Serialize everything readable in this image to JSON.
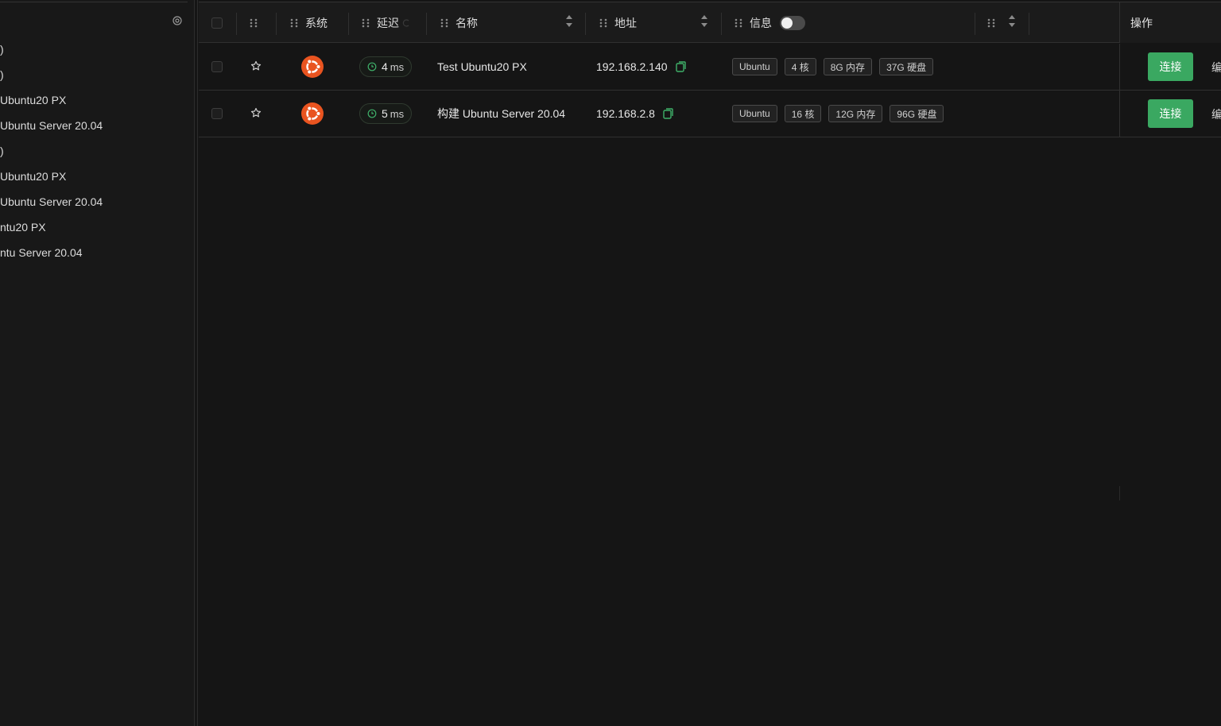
{
  "sidebar": {
    "items": [
      ")",
      ")",
      "Ubuntu20 PX",
      "Ubuntu Server 20.04",
      ")",
      "Ubuntu20 PX",
      "Ubuntu Server 20.04",
      "ntu20 PX",
      "ntu Server 20.04"
    ]
  },
  "table": {
    "headers": {
      "system": "系统",
      "latency": "延迟",
      "name": "名称",
      "address": "地址",
      "info": "信息",
      "operations": "操作"
    },
    "rows": [
      {
        "os": "ubuntu-icon",
        "latency_value": "4",
        "latency_unit": "ms",
        "name": "Test Ubuntu20 PX",
        "address": "192.168.2.140",
        "tags": [
          "Ubuntu",
          "4 核",
          "8G 内存",
          "37G 硬盘"
        ],
        "connect_label": "连接",
        "edit_label": "编"
      },
      {
        "os": "ubuntu-icon",
        "latency_value": "5",
        "latency_unit": "ms",
        "name": "构建 Ubuntu Server 20.04",
        "address": "192.168.2.8",
        "tags": [
          "Ubuntu",
          "16 核",
          "12G 内存",
          "96G 硬盘"
        ],
        "connect_label": "连接",
        "edit_label": "编"
      }
    ]
  },
  "colors": {
    "background": "#151515",
    "accent_green": "#3aa861",
    "ubuntu_orange": "#e95420"
  }
}
